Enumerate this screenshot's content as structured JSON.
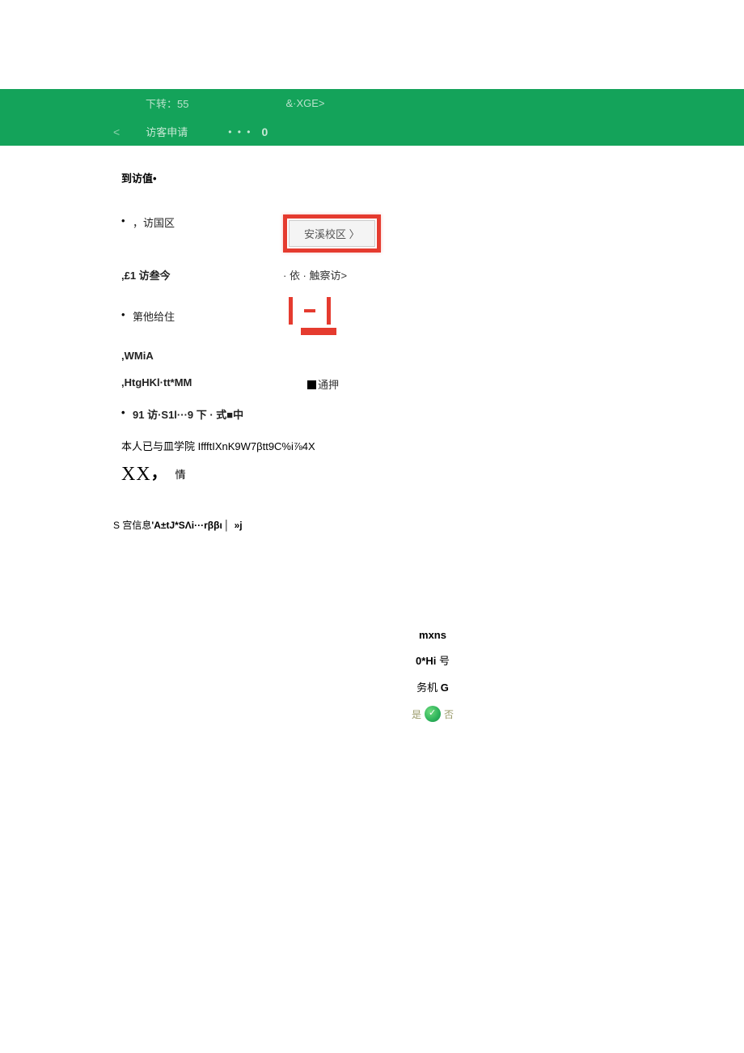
{
  "header": {
    "row1_left": "下转：55",
    "row1_right": "&·XGE>",
    "back_chevron": "<",
    "title": "访客申请",
    "dots": "• • •",
    "zero": "0"
  },
  "content": {
    "visit_value_label": "到访值•",
    "item1": "，访国区",
    "button_label": "安溪校区 〉",
    "item2_label": ",£1 访叁今",
    "item2_right": "· 依 · 触察访>",
    "item3": "第他给住",
    "wmia_label": ",WMiA",
    "htg_label": ",HtgHKl·tt*MM",
    "square_text": "通押",
    "item4": "91 访·S1l···9 下 · 式■中",
    "paragraph": "本人已与皿学院 IffftIXnK9W7βtt9C%i⅞4X",
    "xx": "XX",
    "xx_comma": "，",
    "xx_tail": "情",
    "note_prefix": "S 宫信息",
    "note_bold": "'A±tJ*SΛi···rββι",
    "note_tail": "»j"
  },
  "lower": {
    "line1": "mxns",
    "line2_bold": "0*Hi",
    "line2_tail": " 号",
    "line3_prefix": "务机 ",
    "line3_bold": "G",
    "yes": "是",
    "no": "否"
  }
}
